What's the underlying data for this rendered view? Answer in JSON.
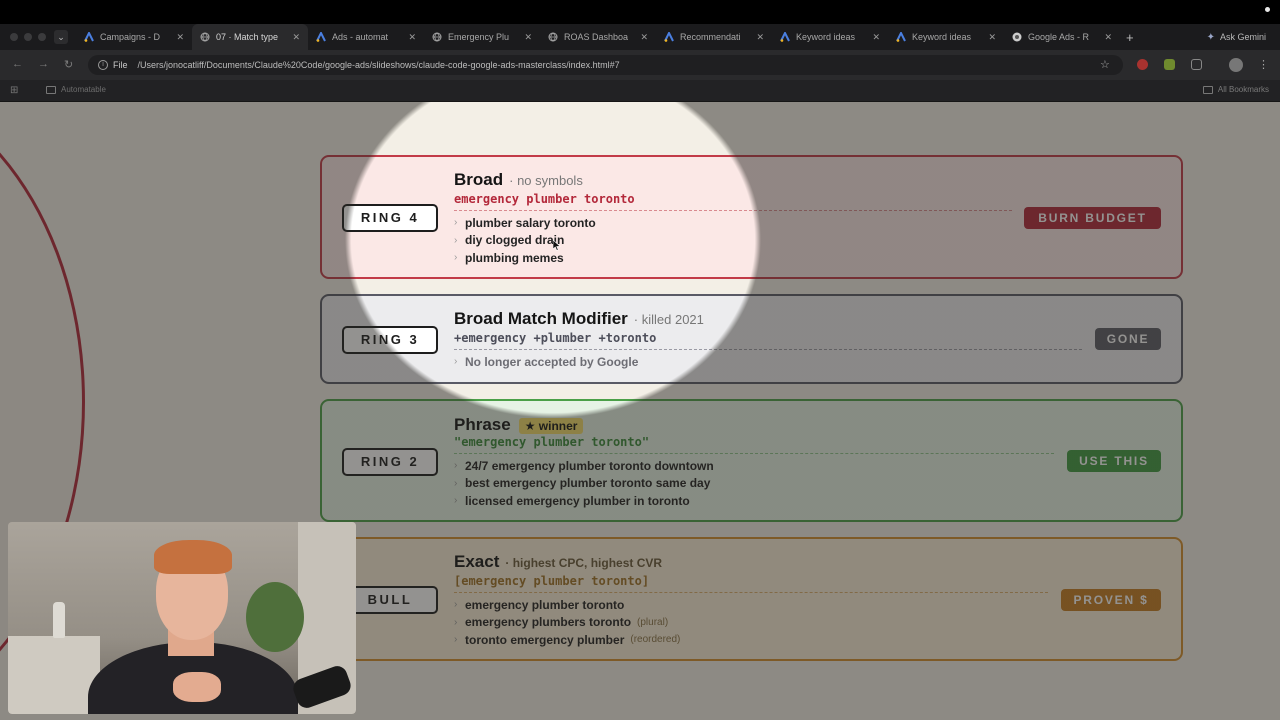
{
  "browser": {
    "tabs": [
      {
        "title": "Campaigns - D",
        "favicon": "google-ads-icon",
        "active": false
      },
      {
        "title": "07 · Match type",
        "favicon": "globe-icon",
        "active": true
      },
      {
        "title": "Ads - automat",
        "favicon": "google-ads-icon",
        "active": false
      },
      {
        "title": "Emergency Plu",
        "favicon": "globe-icon",
        "active": false
      },
      {
        "title": "ROAS Dashboa",
        "favicon": "globe-icon",
        "active": false
      },
      {
        "title": "Recommendati",
        "favicon": "google-ads-icon",
        "active": false
      },
      {
        "title": "Keyword ideas",
        "favicon": "google-ads-icon",
        "active": false
      },
      {
        "title": "Keyword ideas",
        "favicon": "google-ads-icon",
        "active": false
      },
      {
        "title": "Google Ads - R",
        "favicon": "chrome-icon",
        "active": false
      }
    ],
    "gemini_label": "Ask Gemini",
    "url_scheme_label": "File",
    "url": "/Users/jonocatliff/Documents/Claude%20Code/google-ads/slideshows/claude-code-google-ads-masterclass/index.html#7",
    "bookmark_folder": "Automatable",
    "all_bookmarks": "All Bookmarks"
  },
  "slide": {
    "rings": [
      {
        "label": "RING 4",
        "title": "Broad",
        "note": "· no symbols",
        "keyword": "emergency plumber toronto",
        "items": [
          {
            "text": "plumber salary toronto"
          },
          {
            "text": "diy clogged drain"
          },
          {
            "text": "plumbing memes"
          }
        ],
        "badge": "BURN BUDGET"
      },
      {
        "label": "RING 3",
        "title": "Broad Match Modifier",
        "note": "· killed 2021",
        "keyword": "+emergency +plumber +toronto",
        "items": [
          {
            "text": "No longer accepted by Google"
          }
        ],
        "badge": "GONE"
      },
      {
        "label": "RING 2",
        "title": "Phrase",
        "winner": "★ winner",
        "keyword": "\"emergency plumber toronto\"",
        "items": [
          {
            "text": "24/7 emergency plumber toronto downtown"
          },
          {
            "text": "best emergency plumber toronto same day"
          },
          {
            "text": "licensed emergency plumber in toronto"
          }
        ],
        "badge": "USE THIS"
      },
      {
        "label": "BULL",
        "title": "Exact",
        "note": "· highest CPC, highest CVR",
        "keyword": "[emergency plumber toronto]",
        "items": [
          {
            "text": "emergency plumber toronto"
          },
          {
            "text": "emergency plumbers toronto",
            "tag": "(plural)"
          },
          {
            "text": "toronto emergency plumber",
            "tag": "(reordered)"
          }
        ],
        "badge": "PROVEN $"
      }
    ]
  },
  "colors": {
    "broad": "#b3283a",
    "bmm": "#5b5c66",
    "phrase": "#3f9a41",
    "exact": "#c67d22",
    "slide_bg": "#f3efe6"
  }
}
